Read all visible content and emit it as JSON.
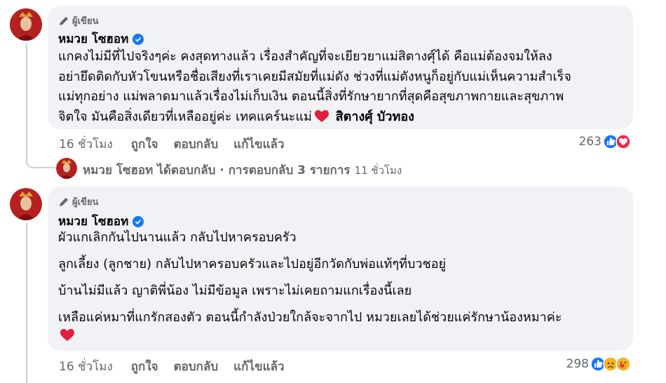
{
  "comment1": {
    "author_badge": "ผู้เขียน",
    "name": "หมวย โซฮอท",
    "lines": [
      "แกคงไม่มีที่ไปจริงๆค่ะ คงสุดทางแล้ว เรื่องสำคัญที่จะเยียวยาแม่สิตางศุ์ได้ คือแม่ต้องจมให้ลง",
      "อย่ายึดติดกับหัวโขนหรือชื่อเสียงที่เราเคยมีสมัยที่แม่ดัง ช่วงที่แม่ดังหนูก็อยู่กับแม่เห็นความสำเร็จ",
      "แม่ทุกอย่าง แม่พลาดมาแล้วเรื่องไม่เก็บเงิน ตอนนี้สิ่งที่รักษายากที่สุดคือสุขภาพกายและสุขภาพ",
      "จิตใจ มันคือสิ่งเดียวที่เหลืออยู่ค่ะ เทคแคร์นะแม่"
    ],
    "mention": "สิตางศุ์ บัวทอง",
    "time": "16 ชั่วโมง",
    "like": "ถูกใจ",
    "reply": "ตอบกลับ",
    "edited": "แก้ไขแล้ว",
    "reaction_count": "263",
    "reactions": [
      "like-icon",
      "love-icon"
    ]
  },
  "reply_summary": {
    "name": "หมวย โซฮอท",
    "text": "ได้ตอบกลับ · การตอบกลับ 3 รายการ",
    "time": "11 ชั่วโมง"
  },
  "comment2": {
    "author_badge": "ผู้เขียน",
    "name": "หมวย โซฮอท",
    "paragraphs": [
      "ผัวแกเลิกกันไปนานแล้ว กลับไปหาครอบครัว",
      "ลูกเลี้ยง (ลูกชาย) กลับไปหาครอบครัวและไปอยู่อีกวัดกับพ่อแท้ๆที่บวชอยู่",
      "บ้านไม่มีแล้ว ญาติพี่น้อง ไม่มีข้อมูล เพราะไม่เคยถามแกเรื่องนี้เลย",
      "เหลือแค่หมาที่แกรักสองตัว ตอนนี้กำลังป่วยใกล้จะจากไป หมวยเลยได้ช่วยแค่รักษาน้องหมาค่ะ"
    ],
    "time": "16 ชั่วโมง",
    "like": "ถูกใจ",
    "reply": "ตอบกลับ",
    "edited": "แก้ไขแล้ว",
    "reaction_count": "298",
    "reactions": [
      "like-icon",
      "sad-icon",
      "care-icon"
    ]
  },
  "colors": {
    "bubble": "#f0f2f5",
    "muted": "#65676b",
    "blue": "#1877f2",
    "red": "#f02849"
  }
}
